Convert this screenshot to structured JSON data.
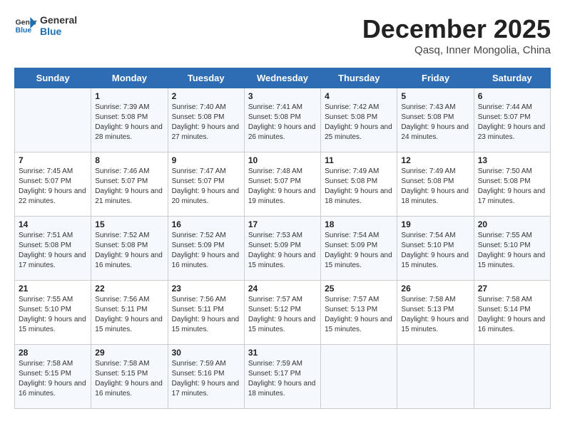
{
  "header": {
    "logo_general": "General",
    "logo_blue": "Blue",
    "month_title": "December 2025",
    "location": "Qasq, Inner Mongolia, China"
  },
  "weekdays": [
    "Sunday",
    "Monday",
    "Tuesday",
    "Wednesday",
    "Thursday",
    "Friday",
    "Saturday"
  ],
  "weeks": [
    [
      {
        "day": "",
        "info": ""
      },
      {
        "day": "1",
        "info": "Sunrise: 7:39 AM\nSunset: 5:08 PM\nDaylight: 9 hours\nand 28 minutes."
      },
      {
        "day": "2",
        "info": "Sunrise: 7:40 AM\nSunset: 5:08 PM\nDaylight: 9 hours\nand 27 minutes."
      },
      {
        "day": "3",
        "info": "Sunrise: 7:41 AM\nSunset: 5:08 PM\nDaylight: 9 hours\nand 26 minutes."
      },
      {
        "day": "4",
        "info": "Sunrise: 7:42 AM\nSunset: 5:08 PM\nDaylight: 9 hours\nand 25 minutes."
      },
      {
        "day": "5",
        "info": "Sunrise: 7:43 AM\nSunset: 5:08 PM\nDaylight: 9 hours\nand 24 minutes."
      },
      {
        "day": "6",
        "info": "Sunrise: 7:44 AM\nSunset: 5:07 PM\nDaylight: 9 hours\nand 23 minutes."
      }
    ],
    [
      {
        "day": "7",
        "info": "Sunrise: 7:45 AM\nSunset: 5:07 PM\nDaylight: 9 hours\nand 22 minutes."
      },
      {
        "day": "8",
        "info": "Sunrise: 7:46 AM\nSunset: 5:07 PM\nDaylight: 9 hours\nand 21 minutes."
      },
      {
        "day": "9",
        "info": "Sunrise: 7:47 AM\nSunset: 5:07 PM\nDaylight: 9 hours\nand 20 minutes."
      },
      {
        "day": "10",
        "info": "Sunrise: 7:48 AM\nSunset: 5:07 PM\nDaylight: 9 hours\nand 19 minutes."
      },
      {
        "day": "11",
        "info": "Sunrise: 7:49 AM\nSunset: 5:08 PM\nDaylight: 9 hours\nand 18 minutes."
      },
      {
        "day": "12",
        "info": "Sunrise: 7:49 AM\nSunset: 5:08 PM\nDaylight: 9 hours\nand 18 minutes."
      },
      {
        "day": "13",
        "info": "Sunrise: 7:50 AM\nSunset: 5:08 PM\nDaylight: 9 hours\nand 17 minutes."
      }
    ],
    [
      {
        "day": "14",
        "info": "Sunrise: 7:51 AM\nSunset: 5:08 PM\nDaylight: 9 hours\nand 17 minutes."
      },
      {
        "day": "15",
        "info": "Sunrise: 7:52 AM\nSunset: 5:08 PM\nDaylight: 9 hours\nand 16 minutes."
      },
      {
        "day": "16",
        "info": "Sunrise: 7:52 AM\nSunset: 5:09 PM\nDaylight: 9 hours\nand 16 minutes."
      },
      {
        "day": "17",
        "info": "Sunrise: 7:53 AM\nSunset: 5:09 PM\nDaylight: 9 hours\nand 15 minutes."
      },
      {
        "day": "18",
        "info": "Sunrise: 7:54 AM\nSunset: 5:09 PM\nDaylight: 9 hours\nand 15 minutes."
      },
      {
        "day": "19",
        "info": "Sunrise: 7:54 AM\nSunset: 5:10 PM\nDaylight: 9 hours\nand 15 minutes."
      },
      {
        "day": "20",
        "info": "Sunrise: 7:55 AM\nSunset: 5:10 PM\nDaylight: 9 hours\nand 15 minutes."
      }
    ],
    [
      {
        "day": "21",
        "info": "Sunrise: 7:55 AM\nSunset: 5:10 PM\nDaylight: 9 hours\nand 15 minutes."
      },
      {
        "day": "22",
        "info": "Sunrise: 7:56 AM\nSunset: 5:11 PM\nDaylight: 9 hours\nand 15 minutes."
      },
      {
        "day": "23",
        "info": "Sunrise: 7:56 AM\nSunset: 5:11 PM\nDaylight: 9 hours\nand 15 minutes."
      },
      {
        "day": "24",
        "info": "Sunrise: 7:57 AM\nSunset: 5:12 PM\nDaylight: 9 hours\nand 15 minutes."
      },
      {
        "day": "25",
        "info": "Sunrise: 7:57 AM\nSunset: 5:13 PM\nDaylight: 9 hours\nand 15 minutes."
      },
      {
        "day": "26",
        "info": "Sunrise: 7:58 AM\nSunset: 5:13 PM\nDaylight: 9 hours\nand 15 minutes."
      },
      {
        "day": "27",
        "info": "Sunrise: 7:58 AM\nSunset: 5:14 PM\nDaylight: 9 hours\nand 16 minutes."
      }
    ],
    [
      {
        "day": "28",
        "info": "Sunrise: 7:58 AM\nSunset: 5:15 PM\nDaylight: 9 hours\nand 16 minutes."
      },
      {
        "day": "29",
        "info": "Sunrise: 7:58 AM\nSunset: 5:15 PM\nDaylight: 9 hours\nand 16 minutes."
      },
      {
        "day": "30",
        "info": "Sunrise: 7:59 AM\nSunset: 5:16 PM\nDaylight: 9 hours\nand 17 minutes."
      },
      {
        "day": "31",
        "info": "Sunrise: 7:59 AM\nSunset: 5:17 PM\nDaylight: 9 hours\nand 18 minutes."
      },
      {
        "day": "",
        "info": ""
      },
      {
        "day": "",
        "info": ""
      },
      {
        "day": "",
        "info": ""
      }
    ]
  ]
}
